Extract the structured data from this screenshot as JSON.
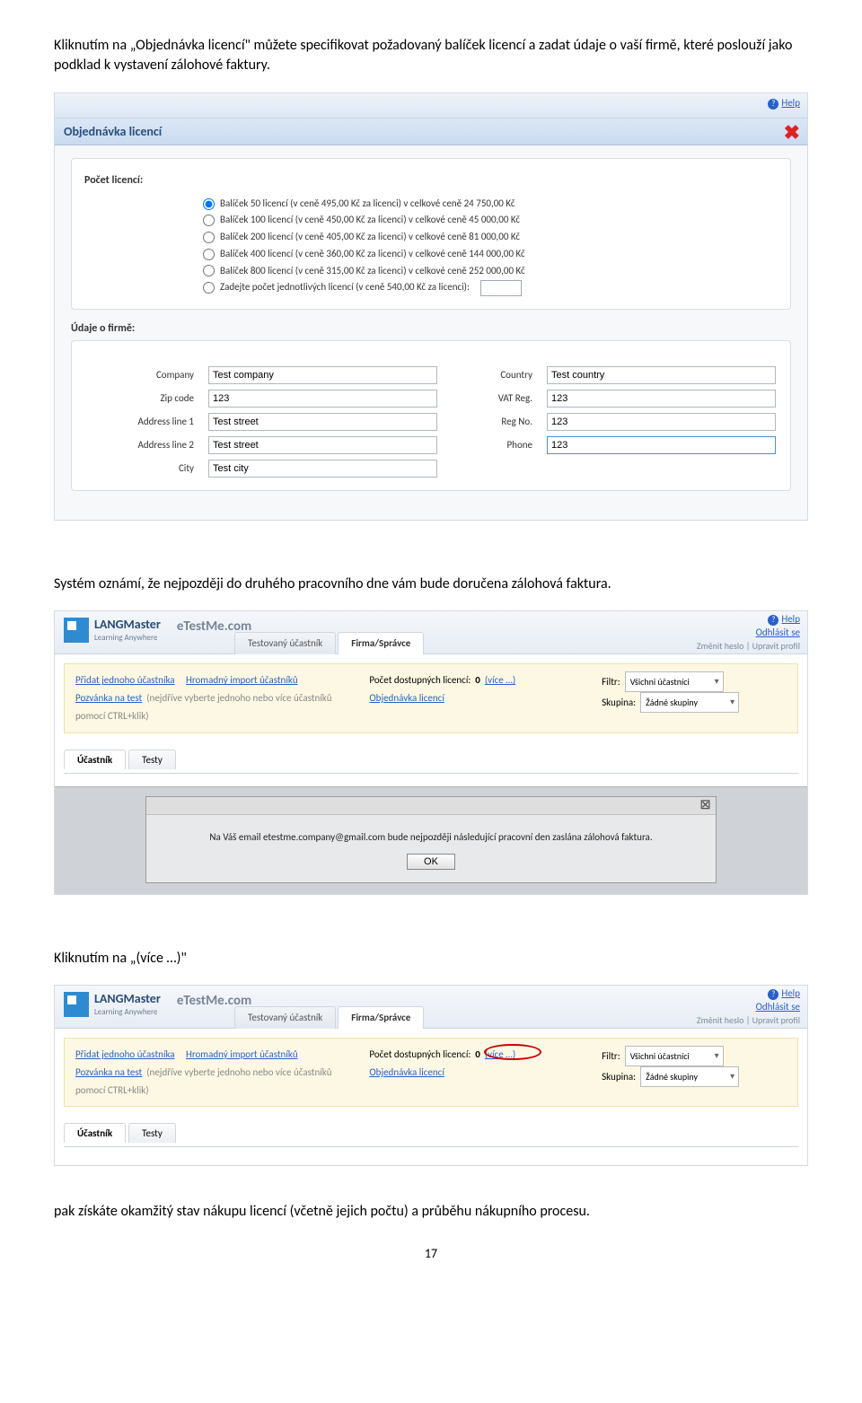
{
  "intro": "Kliknutím na „Objednávka licencí\" můžete specifikovat požadovaný balíček licencí a zadat údaje o vaší firmě, které poslouží jako podklad k vystavení zálohové faktury.",
  "help": "Help",
  "dialog": {
    "title": "Objednávka licencí",
    "pocet_label": "Počet licencí:",
    "options": [
      "Balíček 50 licencí (v ceně 495,00 Kč za licenci) v celkové ceně 24 750,00 Kč",
      "Balíček 100 licencí (v ceně 450,00 Kč za licenci) v celkové ceně 45 000,00 Kč",
      "Balíček 200 licencí (v ceně 405,00 Kč za licenci) v celkové ceně 81 000,00 Kč",
      "Balíček 400 licencí (v ceně 360,00 Kč za licenci) v celkové ceně 144 000,00 Kč",
      "Balíček 800 licencí (v ceně 315,00 Kč za licenci) v celkové ceně 252 000,00 Kč",
      "Zadejte počet jednotlivých licencí (v ceně 540,00 Kč za licenci):"
    ],
    "firm_label": "Údaje o firmě:",
    "fields": {
      "company_l": "Company",
      "company_v": "Test company",
      "country_l": "Country",
      "country_v": "Test country",
      "zip_l": "Zip code",
      "zip_v": "123",
      "vat_l": "VAT Reg.",
      "vat_v": "123",
      "addr1_l": "Address line 1",
      "addr1_v": "Test street",
      "reg_l": "Reg No.",
      "reg_v": "123",
      "addr2_l": "Address line 2",
      "addr2_v": "Test street",
      "phone_l": "Phone",
      "phone_v": "123",
      "city_l": "City",
      "city_v": "Test city"
    }
  },
  "mid_para": "Systém oznámí, že nejpozději do druhého pracovního dne vám bude doručena zálohová faktura.",
  "app": {
    "logo": "LANGMaster",
    "logo_sub": "Learning Anywhere",
    "brand": "eTestMe.com",
    "tab1": "Testovaný účastník",
    "tab2": "Firma/Správce",
    "links": {
      "help": "Help",
      "logout": "Odhlásit se",
      "sub": "Změnit heslo | Upravit profil"
    },
    "panel": {
      "add_one": "Přidat jednoho účastníka",
      "import": "Hromadný import účastníků",
      "invite": "Pozvánka na test",
      "invite_hint": "(nejdříve vyberte jednoho nebo více účastníků pomocí CTRL+klik)",
      "lic_count_label": "Počet dostupných licencí:",
      "lic_count_val": "0",
      "more": "(více …)",
      "order": "Objednávka licencí",
      "filtr_l": "Filtr:",
      "filtr_v": "Všichni účastníci",
      "skupina_l": "Skupina:",
      "skupina_v": "Žádné skupiny"
    },
    "small_tabs": {
      "t1": "Účastník",
      "t2": "Testy"
    },
    "alert": {
      "msg": "Na Váš email etestme.company@gmail.com bude nejpozději následující pracovní den zaslána zálohová faktura.",
      "ok": "OK"
    }
  },
  "para3": "Kliknutím na „(více …)\"",
  "para4": "pak získáte okamžitý stav nákupu licencí (včetně jejich počtu) a průběhu nákupního procesu.",
  "pagenum": "17"
}
